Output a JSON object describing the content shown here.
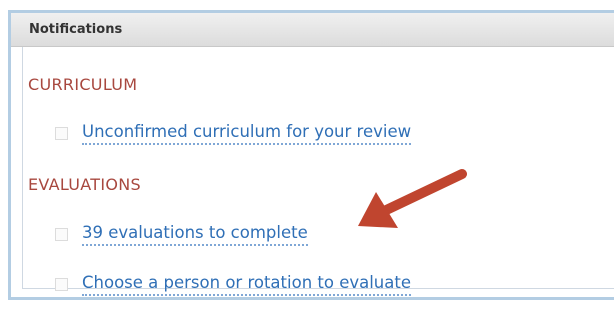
{
  "panel": {
    "title": "Notifications"
  },
  "sections": [
    {
      "title": "CURRICULUM",
      "items": [
        {
          "label": "Unconfirmed curriculum for your review"
        }
      ]
    },
    {
      "title": "EVALUATIONS",
      "items": [
        {
          "label": "39 evaluations to complete"
        },
        {
          "label": "Choose a person or rotation to evaluate"
        }
      ]
    }
  ],
  "annotation": {
    "arrow_color": "#c0452f",
    "icon": "red-arrow-icon"
  },
  "colors": {
    "section_title": "#a8483f",
    "link": "#2f6fb6",
    "frame_border": "#b3cde3"
  }
}
